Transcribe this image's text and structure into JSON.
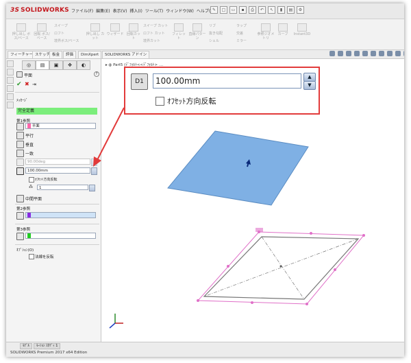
{
  "app": {
    "logo_ds": "3S",
    "logo_text": "SOLIDWORKS",
    "menu": [
      "ファイル(F)",
      "編集(E)",
      "表示(V)",
      "挿入(I)",
      "ツール(T)",
      "ウィンドウ(W)",
      "ヘルプ(H)"
    ]
  },
  "ribbon": {
    "items": [
      "押し出し ボス/ベース",
      "回転 ボス/ベース",
      "スイープ",
      "ロフト",
      "境界ボス/ベース",
      "押し出し カット",
      "ウィザード",
      "回転カット",
      "スイープ カット",
      "ロフト カット",
      "境界カット",
      "フィレット",
      "直線パターン",
      "リブ",
      "抜き勾配",
      "シェル",
      "ラップ",
      "交差",
      "ミラー",
      "参照ジオメトリ",
      "カーブ",
      "Instant3D"
    ]
  },
  "tabs": [
    "フィーチャー",
    "スケッチ",
    "板金",
    "評価",
    "DimXpert",
    "SOLIDWORKS アドイン"
  ],
  "panel": {
    "tab_icons": [
      "◎",
      "▤",
      "▣",
      "✥",
      "◐"
    ],
    "title": "平面",
    "help": "?",
    "ok": "✔",
    "cancel": "✖",
    "pin": "⇥",
    "message_header": "ﾒｯｾｰｼﾞ",
    "message": "完全定義",
    "ref1_header": "第1参照",
    "ref1_field": "平面",
    "options": [
      "平行",
      "垂直",
      "一致"
    ],
    "angle": "90.00deg",
    "offset": "100.00mm",
    "offset_flip": "ｵﾌｾｯﾄ方向反転",
    "count": "1",
    "midplane": "中間平面",
    "ref2_header": "第2参照",
    "ref3_header": "第3参照",
    "options_header": "ｵﾌﾟｼｮﾝ(O)",
    "flip_normal": "法線を反転"
  },
  "viewport": {
    "tree_label": "Part5 (ﾃﾞﾌｫﾙﾄ<<ﾃﾞﾌｫﾙﾄ>_..."
  },
  "callout": {
    "dim_label": "D1",
    "value": "100.00mm",
    "checkbox_label": "ｵﾌｾｯﾄ方向反転",
    "border_color": "#e23b3b"
  },
  "status": {
    "tabs": [
      "ﾓﾃﾞﾙ",
      "ﾓｰｼｮﾝ ｽﾀﾃﾞｨ 1"
    ],
    "text": "SOLIDWORKS Premium 2017 x64 Edition"
  },
  "colors": {
    "plane_fill": "#7fb0e4",
    "preview_edge": "#e070c8",
    "message_bg": "#7cee7c",
    "ref1_color": "#ff66aa",
    "ref2_color": "#8a2be2",
    "ref3_color": "#22cc22"
  }
}
